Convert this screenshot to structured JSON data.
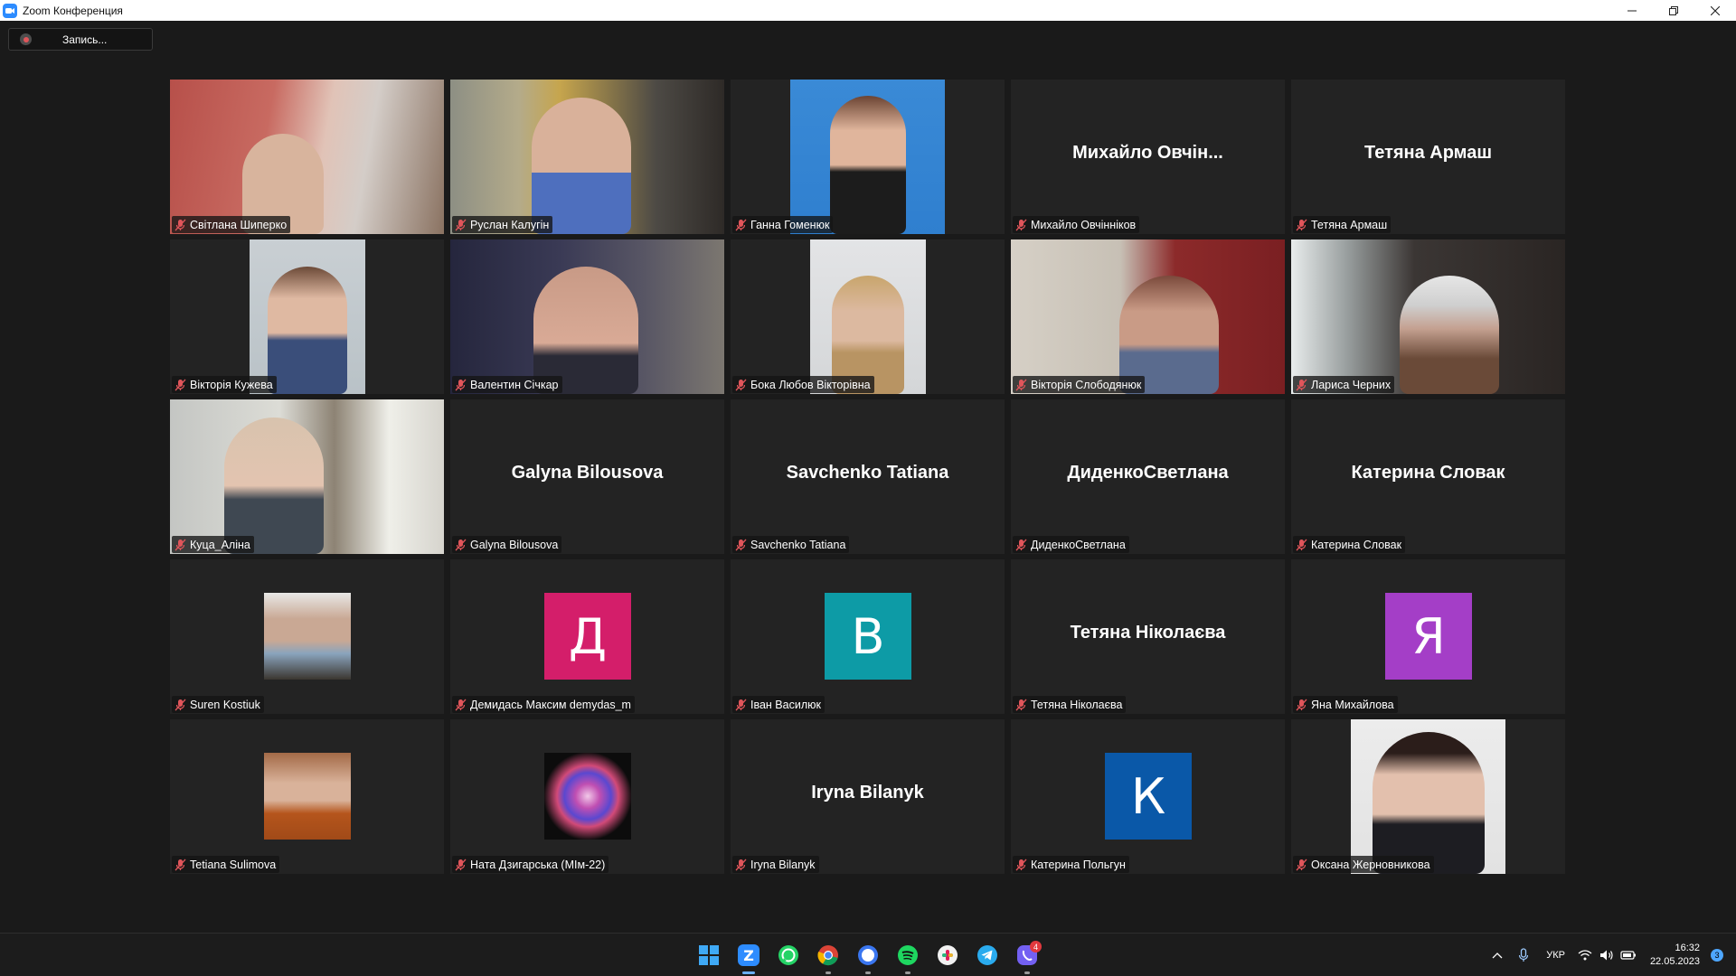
{
  "window": {
    "title": "Zoom Конференция"
  },
  "recording": {
    "label": "Запись..."
  },
  "tiles": [
    {
      "name": "Світлана Шиперко",
      "type": "video"
    },
    {
      "name": "Руслан Калугін",
      "type": "video"
    },
    {
      "name": "Ганна Гоменюк",
      "type": "video"
    },
    {
      "name": "Михайло Овчінніков",
      "big_name": "Михайло Овчін...",
      "type": "name"
    },
    {
      "name": "Тетяна Армаш",
      "big_name": "Тетяна Армаш",
      "type": "name"
    },
    {
      "name": "Вікторія Кужева",
      "type": "video"
    },
    {
      "name": "Валентин Січкар",
      "type": "video"
    },
    {
      "name": "Бока Любов Вікторівна",
      "type": "video"
    },
    {
      "name": "Вікторія Слободянюк",
      "type": "video"
    },
    {
      "name": "Лариса Черних",
      "type": "video"
    },
    {
      "name": "Куца_Аліна",
      "type": "video"
    },
    {
      "name": "Galyna Bilousova",
      "big_name": "Galyna Bilousova",
      "type": "name"
    },
    {
      "name": "Savchenko Tatiana",
      "big_name": "Savchenko Tatiana",
      "type": "name"
    },
    {
      "name": "ДиденкоСветлана",
      "big_name": "ДиденкоСветлана",
      "type": "name"
    },
    {
      "name": "Катерина Словак",
      "big_name": "Катерина Словак",
      "type": "name"
    },
    {
      "name": "Suren Kostiuk",
      "type": "photo"
    },
    {
      "name": "Демидась Максим demydas_m",
      "type": "avatar",
      "letter": "Д",
      "color": "#d41e6a"
    },
    {
      "name": "Іван Василюк",
      "type": "avatar",
      "letter": "В",
      "color": "#0d9ba6"
    },
    {
      "name": "Тетяна Ніколаєва",
      "big_name": "Тетяна Ніколаєва",
      "type": "name"
    },
    {
      "name": "Яна Михайлова",
      "type": "avatar",
      "letter": "Я",
      "color": "#a43ec7"
    },
    {
      "name": "Tetiana Sulimova",
      "type": "photo"
    },
    {
      "name": "Ната Дзигарська (МІм-22)",
      "type": "photo"
    },
    {
      "name": "Iryna Bilanyk",
      "big_name": "Iryna Bilanyk",
      "type": "name"
    },
    {
      "name": "Катерина Польгун",
      "type": "avatar",
      "letter": "К",
      "color": "#0a58a8"
    },
    {
      "name": "Оксана Жерновникова",
      "type": "video"
    }
  ],
  "taskbar": {
    "apps": [
      "windows-start",
      "zoom",
      "whatsapp",
      "chrome",
      "signal",
      "spotify",
      "slack",
      "telegram",
      "viber"
    ],
    "viber_badge": "4",
    "language": "УКР",
    "time": "16:32",
    "date": "22.05.2023",
    "notifications": "3"
  },
  "colors": {
    "accent": "#2d8cff",
    "muted_mic": "#e0555a"
  }
}
